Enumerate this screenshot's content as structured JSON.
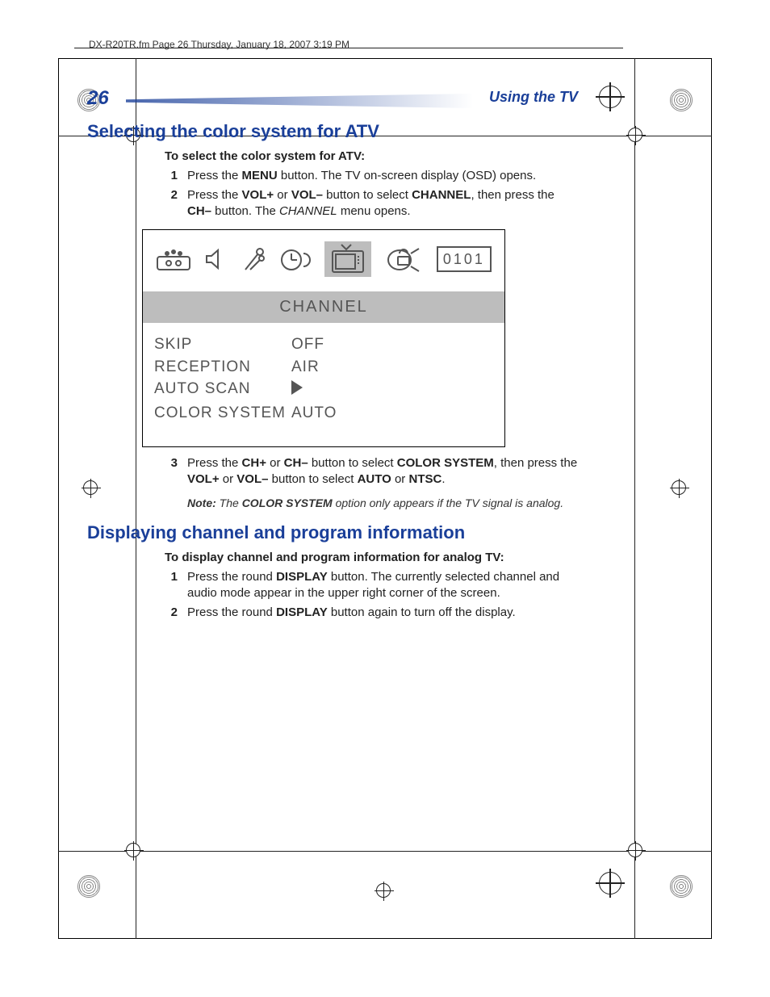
{
  "running_head": "DX-R20TR.fm  Page 26  Thursday, January 18, 2007  3:19 PM",
  "page_number": "26",
  "section_title": "Using the TV",
  "headings": {
    "h1": "Selecting the color system for ATV",
    "h2": "Displaying channel and program information"
  },
  "section1": {
    "lead": "To select the color system for ATV:",
    "step1_num": "1",
    "step1_pre": "Press the ",
    "step1_b1": "MENU",
    "step1_post": " button. The TV on-screen display (OSD) opens.",
    "step2_num": "2",
    "step2_pre": "Press the ",
    "step2_b1": "VOL+",
    "step2_mid1": " or ",
    "step2_b2": "VOL–",
    "step2_mid2": " button to select ",
    "step2_b3": "CHANNEL",
    "step2_mid3": ", then press the ",
    "step2_b4": "CH–",
    "step2_mid4": " button. The ",
    "step2_ital": "CHANNEL",
    "step2_post": " menu opens.",
    "step3_num": "3",
    "step3_pre": "Press the ",
    "step3_b1": "CH+",
    "step3_mid1": " or ",
    "step3_b2": "CH–",
    "step3_mid2": " button to select ",
    "step3_b3": "COLOR SYSTEM",
    "step3_mid3": ", then press the ",
    "step3_b4": "VOL+",
    "step3_mid4": " or ",
    "step3_b5": "VOL–",
    "step3_mid5": " button to select ",
    "step3_b6": "AUTO",
    "step3_mid6": " or ",
    "step3_b7": "NTSC",
    "step3_post": ".",
    "note_label": "Note:",
    "note_pre": " The ",
    "note_b": "COLOR SYSTEM",
    "note_post": " option only appears if the TV signal is analog."
  },
  "osd": {
    "code": "0101",
    "title": "CHANNEL",
    "rows": {
      "r1_label": "SKIP",
      "r1_value": "OFF",
      "r2_label": "RECEPTION",
      "r2_value": "AIR",
      "r3_label": "AUTO SCAN",
      "r4_label": "COLOR SYSTEM",
      "r4_value": "AUTO"
    }
  },
  "section2": {
    "lead": "To display channel and program information for analog TV:",
    "step1_num": "1",
    "step1_pre": "Press the round ",
    "step1_b1": "DISPLAY",
    "step1_post": " button. The currently selected channel and audio mode appear in the upper right corner of the screen.",
    "step2_num": "2",
    "step2_pre": "Press the round ",
    "step2_b1": "DISPLAY",
    "step2_post": " button again to turn off the display."
  }
}
